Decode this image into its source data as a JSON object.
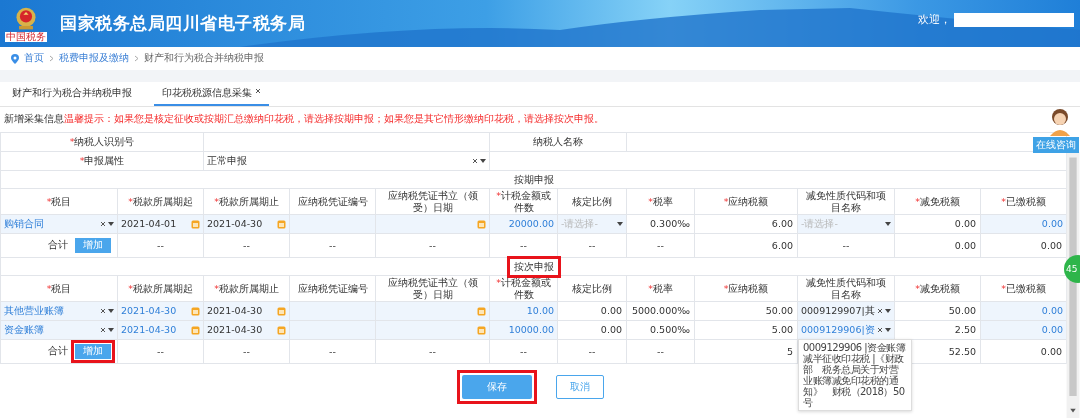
{
  "header": {
    "title": "国家税务总局四川省电子税务局",
    "logo_text": "中国税务",
    "greeting": "欢迎，"
  },
  "breadcrumb": [
    {
      "label": "首页",
      "current": false
    },
    {
      "label": "税费申报及缴纳",
      "current": false
    },
    {
      "label": "财产和行为税合并纳税申报",
      "current": true
    }
  ],
  "tabs": [
    {
      "label": "财产和行为税合并纳税申报",
      "selected": false,
      "closable": false
    },
    {
      "label": "印花税税源信息采集",
      "selected": true,
      "closable": true
    }
  ],
  "notice": {
    "label": "新增采集信息",
    "warning": "温馨提示：如果您是核定征收或按期汇总缴纳印花税，请选择按期申报；如果您是其它情形缴纳印花税，请选择按次申报。"
  },
  "form_rows": [
    {
      "cells": [
        {
          "kind": "label",
          "marker": "*",
          "text": "纳税人识别号"
        },
        {
          "kind": "blank"
        },
        {
          "kind": "label",
          "text": "纳税人名称"
        },
        {
          "kind": "blank"
        }
      ]
    },
    {
      "cells": [
        {
          "kind": "label",
          "marker": "*",
          "text": "申报属性"
        },
        {
          "kind": "select",
          "value": "正常申报"
        },
        {
          "kind": "blank"
        }
      ]
    }
  ],
  "sections": [
    {
      "title": "按期申报",
      "highlighted": false,
      "columns": [
        {
          "marker": "*",
          "label": "税目"
        },
        {
          "marker": "*",
          "label": "税款所属期起"
        },
        {
          "marker": "*",
          "label": "税款所属期止"
        },
        {
          "label": "应纳税凭证编号"
        },
        {
          "label": "应纳税凭证书立（领受）日期"
        },
        {
          "marker": "*",
          "label": "计税金额或件数"
        },
        {
          "label": "核定比例"
        },
        {
          "marker": "*",
          "label": "税率"
        },
        {
          "marker": "*",
          "label": "应纳税额"
        },
        {
          "label": "减免性质代码和项目名称"
        },
        {
          "marker": "*",
          "label": "减免税额"
        },
        {
          "marker": "*",
          "label": "已缴税额"
        }
      ],
      "rows": [
        {
          "cells": [
            {
              "kind": "select",
              "value": "购销合同",
              "modified": true
            },
            {
              "kind": "date",
              "value": "2021-04-01",
              "modified": false
            },
            {
              "kind": "date",
              "value": "2021-04-30",
              "modified": false
            },
            {
              "kind": "input"
            },
            {
              "kind": "date"
            },
            {
              "kind": "input",
              "value": "20000.00"
            },
            {
              "kind": "select",
              "placeholder": "-请选择-"
            },
            {
              "kind": "text",
              "value": "0.300‰"
            },
            {
              "kind": "text",
              "value": "6.00"
            },
            {
              "kind": "select",
              "placeholder": "-请选择-"
            },
            {
              "kind": "text",
              "value": "0.00"
            },
            {
              "kind": "input",
              "value": "0.00"
            }
          ]
        }
      ],
      "total": {
        "label": "合计",
        "button": "增加",
        "button_highlighted": false,
        "values": [
          "--",
          "--",
          "--",
          "--",
          "--",
          "--",
          "--",
          "6.00"
        ],
        "exemption_total": "--",
        "tail_values": [
          "0.00",
          "0.00"
        ]
      }
    },
    {
      "title": "按次申报",
      "highlighted": true,
      "columns": [
        {
          "marker": "*",
          "label": "税目"
        },
        {
          "marker": "*",
          "label": "税款所属期起"
        },
        {
          "marker": "*",
          "label": "税款所属期止"
        },
        {
          "label": "应纳税凭证编号"
        },
        {
          "label": "应纳税凭证书立（领受）日期"
        },
        {
          "marker": "*",
          "label": "计税金额或件数"
        },
        {
          "label": "核定比例"
        },
        {
          "marker": "*",
          "label": "税率"
        },
        {
          "marker": "*",
          "label": "应纳税额"
        },
        {
          "label": "减免性质代码和项目名称"
        },
        {
          "marker": "*",
          "label": "减免税额"
        },
        {
          "marker": "*",
          "label": "已缴税额"
        }
      ],
      "rows": [
        {
          "cells": [
            {
              "kind": "select",
              "value": "其他营业账簿",
              "modified": true
            },
            {
              "kind": "date",
              "value": "2021-04-30",
              "modified": true
            },
            {
              "kind": "date",
              "value": "2021-04-30",
              "modified": false
            },
            {
              "kind": "input"
            },
            {
              "kind": "date"
            },
            {
              "kind": "input",
              "value": "10.00"
            },
            {
              "kind": "text",
              "value": "0.00"
            },
            {
              "kind": "text",
              "value": "5000.000‰"
            },
            {
              "kind": "text",
              "value": "50.00"
            },
            {
              "kind": "select",
              "value": "0009129907|其",
              "modified": false
            },
            {
              "kind": "text",
              "value": "50.00"
            },
            {
              "kind": "input",
              "value": "0.00"
            }
          ]
        },
        {
          "cells": [
            {
              "kind": "select",
              "value": "资金账簿",
              "modified": true
            },
            {
              "kind": "date",
              "value": "2021-04-30",
              "modified": true
            },
            {
              "kind": "date",
              "value": "2021-04-30",
              "modified": false
            },
            {
              "kind": "input"
            },
            {
              "kind": "date"
            },
            {
              "kind": "input",
              "value": "10000.00"
            },
            {
              "kind": "text",
              "value": "0.00"
            },
            {
              "kind": "text",
              "value": "0.500‰"
            },
            {
              "kind": "text",
              "value": "5.00"
            },
            {
              "kind": "select",
              "value": "0009129906|资",
              "modified": true,
              "tooltip": "0009129906 |资金账簿减半征收印花税 |《财政部　税务总局关于对营业账簿减免印花税的通知》　财税（2018）50号"
            },
            {
              "kind": "text",
              "value": "2.50"
            },
            {
              "kind": "input",
              "value": "0.00"
            }
          ]
        }
      ],
      "total": {
        "label": "合计",
        "button": "增加",
        "button_highlighted": true,
        "values": [
          "--",
          "--",
          "--",
          "--",
          "--",
          "--",
          "--",
          "5"
        ],
        "tail_values": [
          "52.50",
          "0.00"
        ]
      }
    }
  ],
  "actions": [
    {
      "label": "保存",
      "kind": "primary",
      "highlighted": true
    },
    {
      "label": "取消",
      "kind": "secondary",
      "highlighted": false
    }
  ],
  "service": {
    "label": "在线咨询",
    "badge": "45"
  }
}
